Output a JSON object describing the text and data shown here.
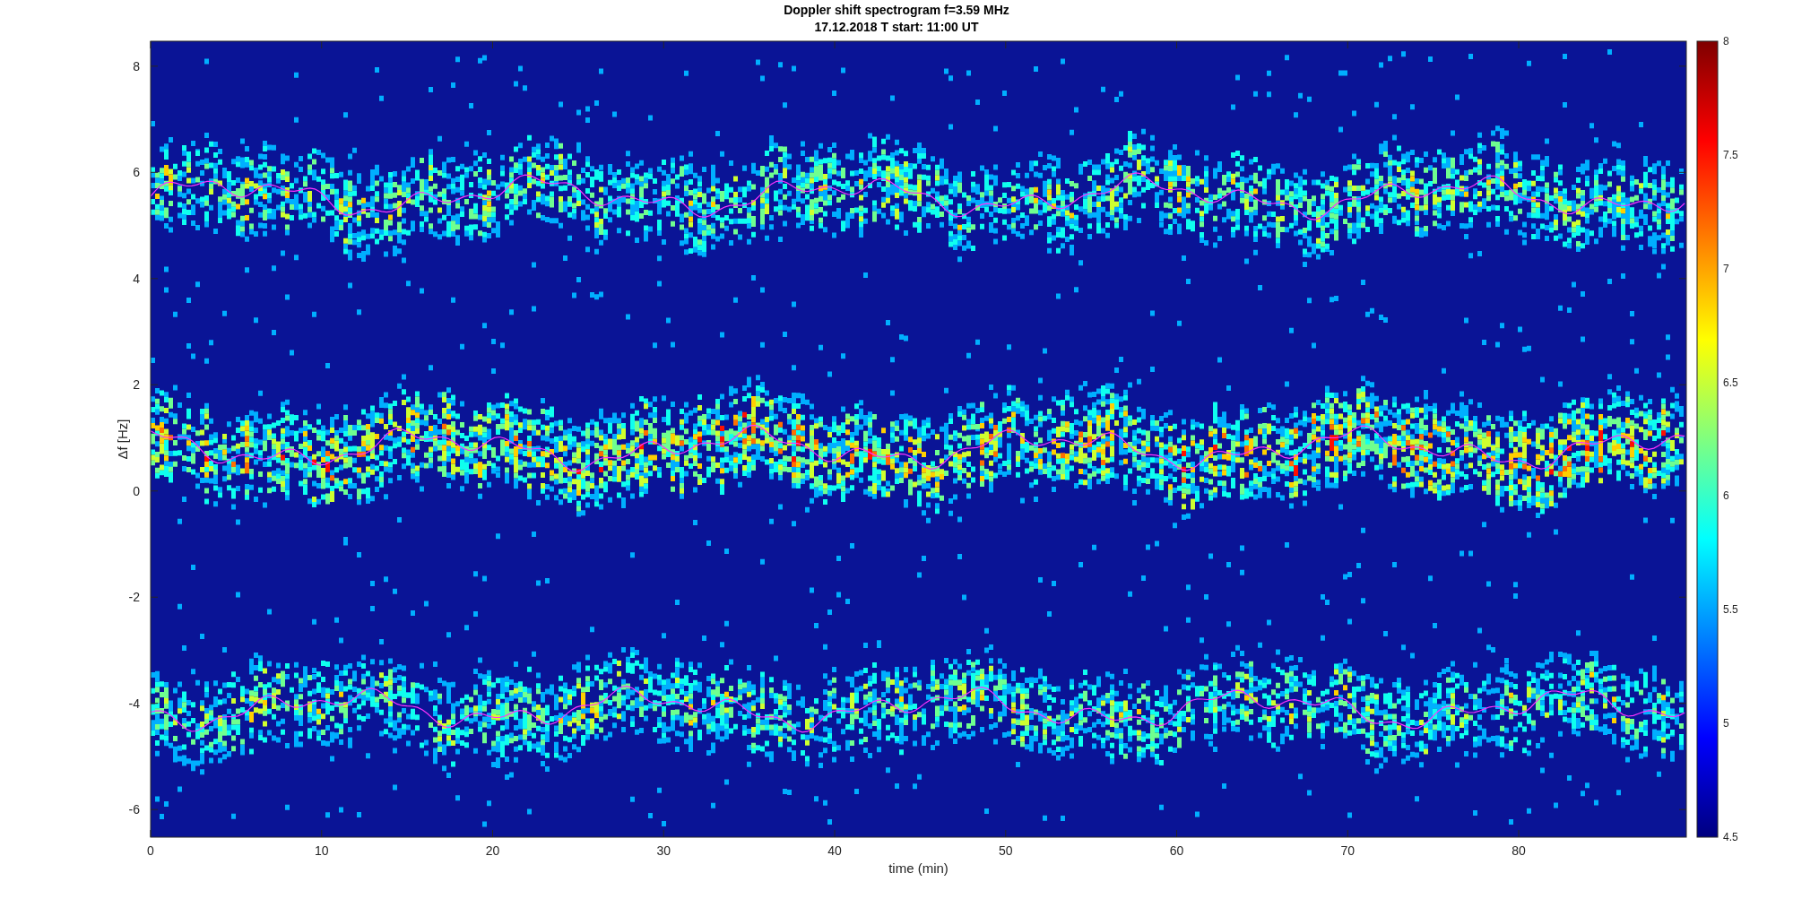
{
  "figure": {
    "title": "Doppler shift spectrogram f=3.59 MHz",
    "subtitle": "17.12.2018   T start: 11:00 UT"
  },
  "axes": {
    "ylabel": "Δf [Hz]",
    "xlabel": "time (min)",
    "y_ticks": [
      "8",
      "6",
      "4",
      "2",
      "0",
      "-2",
      "-4",
      "-6"
    ],
    "x_ticks": [
      "0",
      "10",
      "20",
      "30",
      "40",
      "50",
      "60",
      "70",
      "80"
    ]
  },
  "colorbar": {
    "ticks": [
      "8",
      "7.5",
      "7",
      "6.5",
      "6",
      "5.5",
      "5",
      "4.5"
    ]
  }
}
